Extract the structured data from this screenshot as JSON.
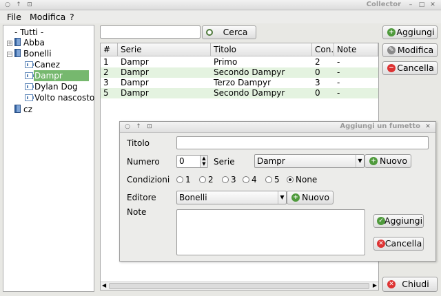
{
  "window": {
    "title": "Collector"
  },
  "menu": {
    "file": "File",
    "modifica": "Modifica",
    "help": "?"
  },
  "tree": {
    "root": "- Tutti -",
    "items": [
      {
        "label": "Abba"
      },
      {
        "label": "Bonelli"
      },
      {
        "label": "Canez"
      },
      {
        "label": "Dampr"
      },
      {
        "label": "Dylan Dog"
      },
      {
        "label": "Volto nascosto"
      },
      {
        "label": "cz"
      }
    ]
  },
  "search": {
    "value": "",
    "button": "Cerca"
  },
  "actions": {
    "add": "Aggiungi",
    "edit": "Modifica",
    "delete": "Cancella",
    "close": "Chiudi"
  },
  "table": {
    "columns": [
      "#",
      "Serie",
      "Titolo",
      "Con.",
      "Note"
    ],
    "rows": [
      [
        "1",
        "Dampr",
        "Primo",
        "2",
        "-"
      ],
      [
        "2",
        "Dampr",
        "Secondo Dampyr",
        "0",
        "-"
      ],
      [
        "3",
        "Dampr",
        "Terzo Dampyr",
        "3",
        "-"
      ],
      [
        "5",
        "Dampr",
        "Secondo Dampyr",
        "0",
        "-"
      ]
    ]
  },
  "dialog": {
    "title": "Aggiungi un fumetto",
    "titolo_label": "Titolo",
    "titolo_value": "",
    "numero_label": "Numero",
    "numero_value": "0",
    "serie_label": "Serie",
    "serie_value": "Dampr",
    "nuovo": "Nuovo",
    "condizioni_label": "Condizioni",
    "condizioni_options": [
      "1",
      "2",
      "3",
      "4",
      "5",
      "None"
    ],
    "condizioni_selected": "None",
    "editore_label": "Editore",
    "editore_value": "Bonelli",
    "note_label": "Note",
    "note_value": "",
    "add": "Aggiungi",
    "cancel": "Cancella"
  },
  "colors": {
    "selection": "#76b86e",
    "row_alt": "#e4f3e0",
    "add_icon": "#4f9a3c",
    "delete_icon": "#dd3333"
  }
}
